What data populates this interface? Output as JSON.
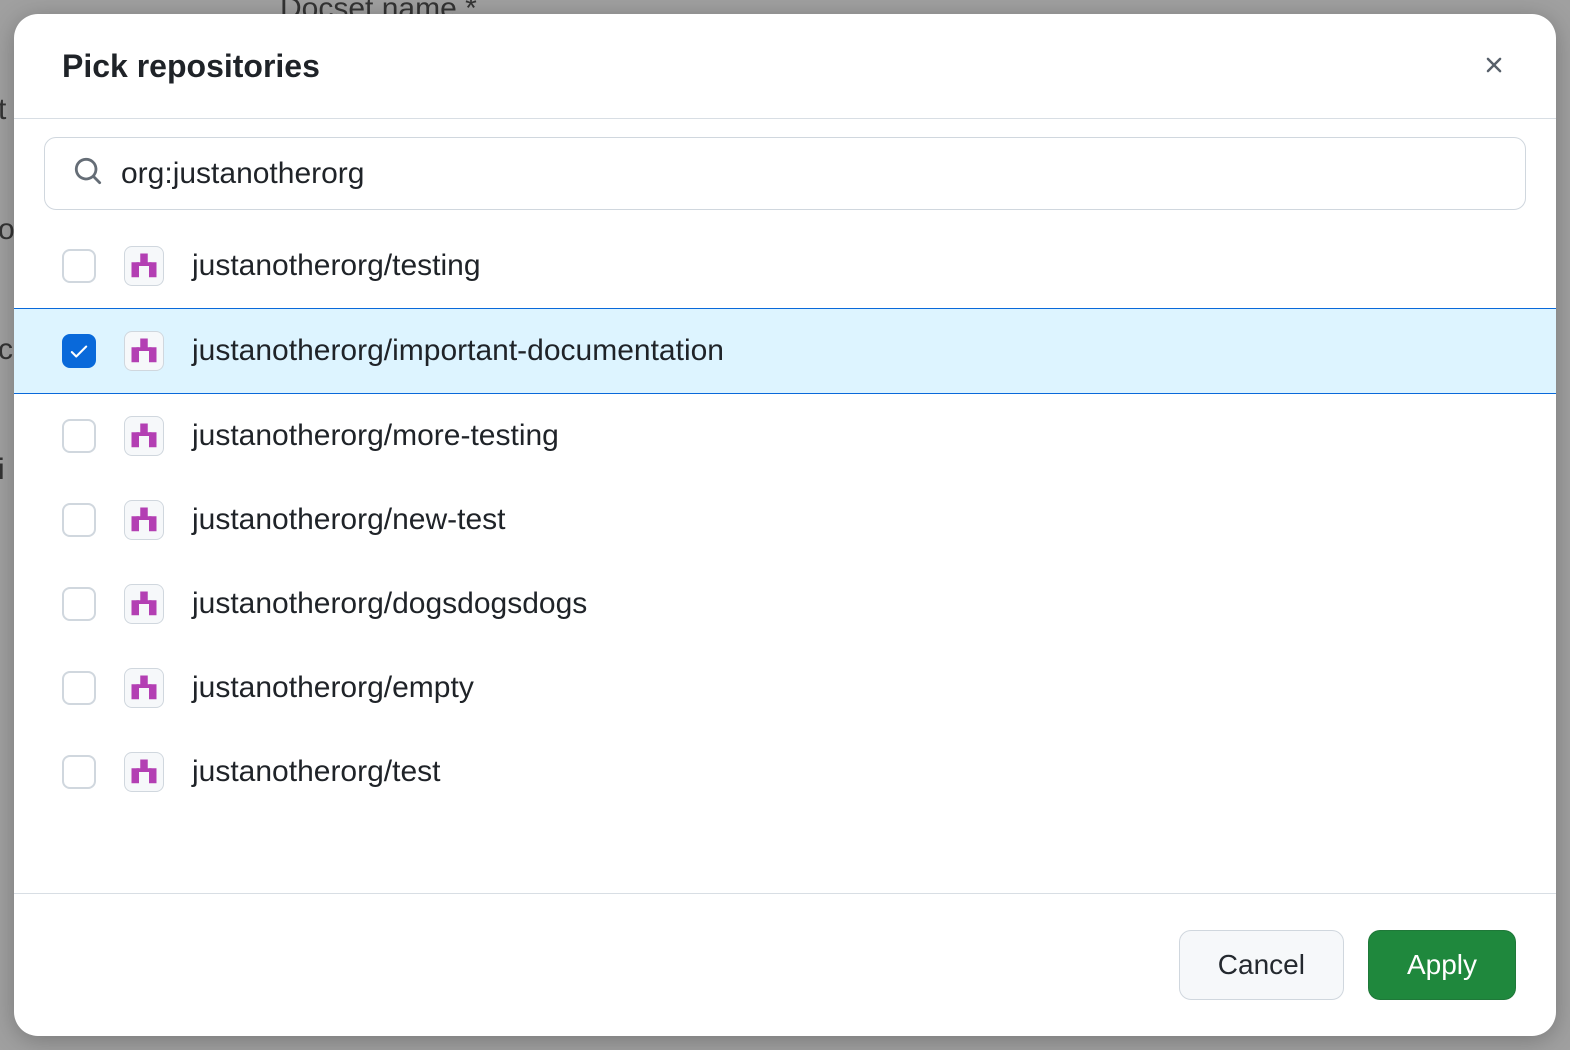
{
  "background": {
    "field_label_partial": "Docset name *"
  },
  "modal": {
    "title": "Pick repositories",
    "search": {
      "value": "org:justanotherorg",
      "placeholder": ""
    },
    "repos": [
      {
        "name": "justanotherorg/testing",
        "checked": false
      },
      {
        "name": "justanotherorg/important-documentation",
        "checked": true
      },
      {
        "name": "justanotherorg/more-testing",
        "checked": false
      },
      {
        "name": "justanotherorg/new-test",
        "checked": false
      },
      {
        "name": "justanotherorg/dogsdogsdogs",
        "checked": false
      },
      {
        "name": "justanotherorg/empty",
        "checked": false
      },
      {
        "name": "justanotherorg/test",
        "checked": false
      }
    ],
    "footer": {
      "cancel_label": "Cancel",
      "apply_label": "Apply"
    }
  },
  "colors": {
    "primary_blue": "#0969da",
    "selected_bg": "#ddf4ff",
    "apply_green": "#1f883d",
    "avatar_purple": "#b33fb3"
  }
}
